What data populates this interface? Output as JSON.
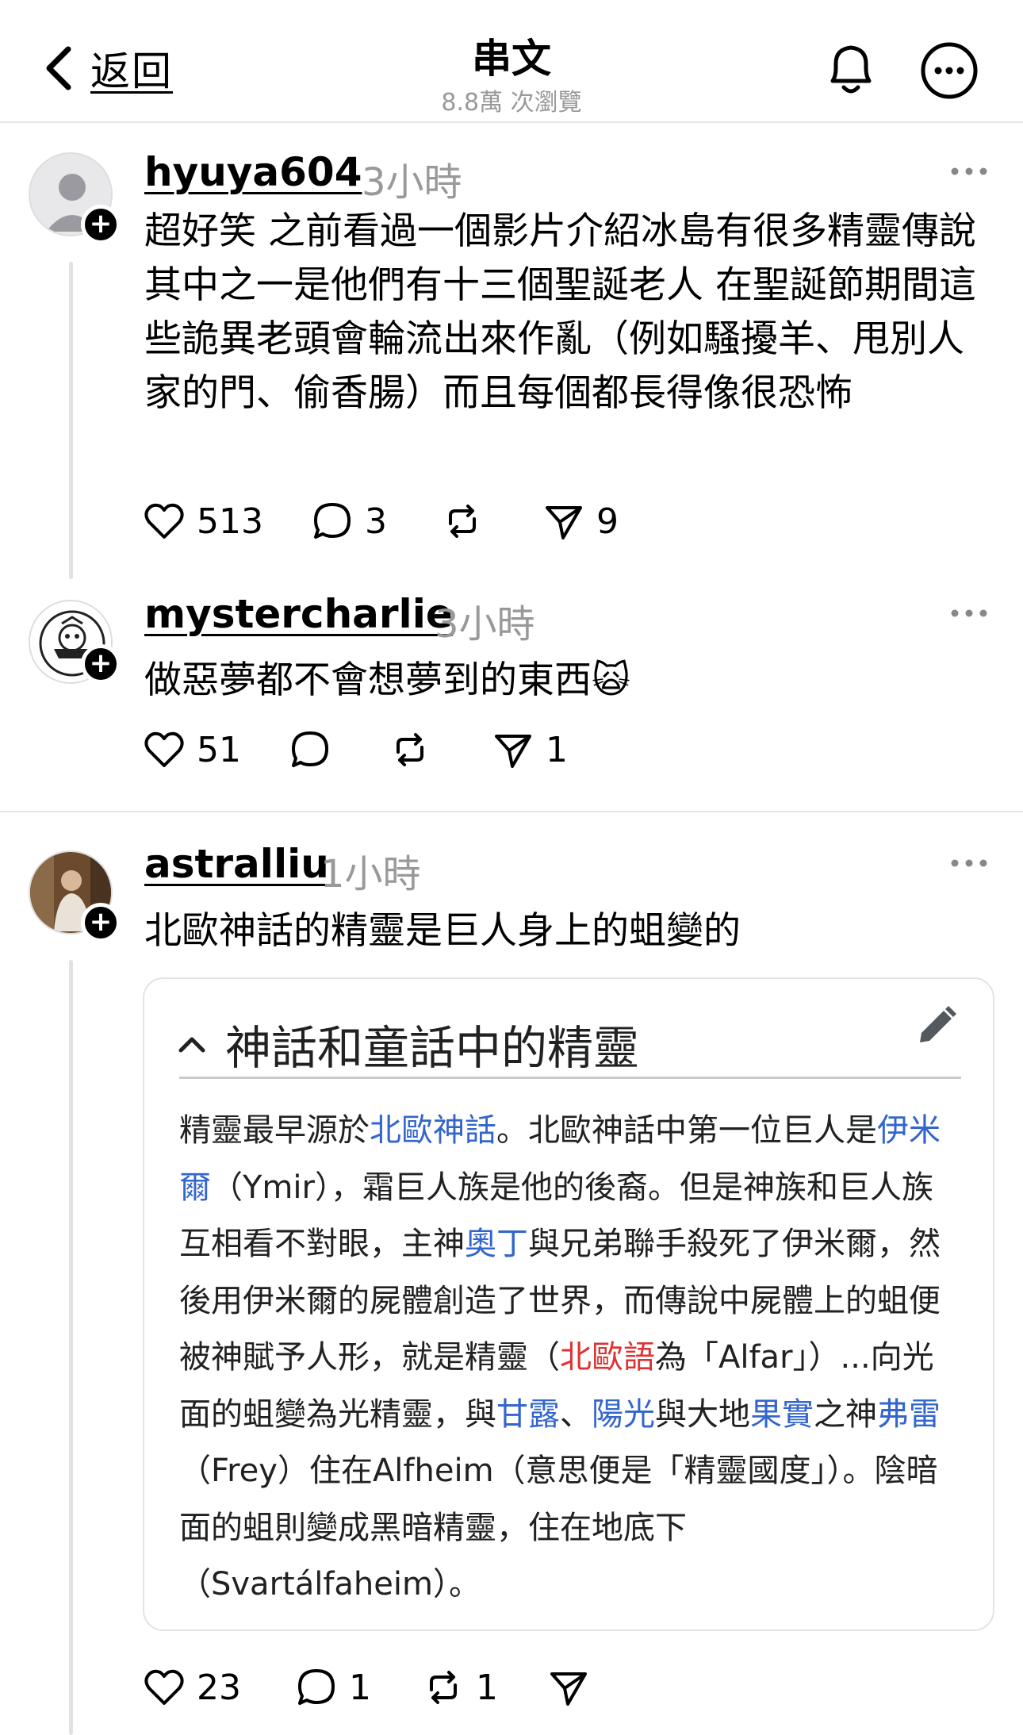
{
  "header": {
    "back_label": "返回",
    "title": "串文",
    "subtitle": "8.8萬 次瀏覽"
  },
  "posts": [
    {
      "username": "hyuya604",
      "time": "3小時",
      "text": "超好笑 之前看過一個影片介紹冰島有很多精靈傳說 其中之一是他們有十三個聖誕老人 在聖誕節期間這些詭異老頭會輪流出來作亂（例如騷擾羊、甩別人家的門、偷香腸）而且每個都長得像很恐怖",
      "likes": "513",
      "replies": "3",
      "reposts": "",
      "shares": "9"
    },
    {
      "username": "mystercharlie",
      "time": "3小時",
      "text": "做惡夢都不會想夢到的東西",
      "emoji": "🙀",
      "likes": "51",
      "replies": "",
      "reposts": "",
      "shares": "1"
    },
    {
      "username": "astralliu",
      "time": "1小時",
      "text": "北歐神話的精靈是巨人身上的蛆變的",
      "likes": "23",
      "replies": "1",
      "reposts": "1",
      "shares": ""
    }
  ],
  "wiki": {
    "title": "神話和童話中的精靈",
    "segments": [
      {
        "t": "精靈最早源於",
        "c": ""
      },
      {
        "t": "北歐神話",
        "c": "link"
      },
      {
        "t": "。北歐神話中第一位巨人是",
        "c": ""
      },
      {
        "t": "伊米爾",
        "c": "link"
      },
      {
        "t": "（Ymir），霜巨人族是他的後裔。但是神族和巨人族互相看不對眼，主神",
        "c": ""
      },
      {
        "t": "奧丁",
        "c": "link"
      },
      {
        "t": "與兄弟聯手殺死了伊米爾，然後用伊米爾的屍體創造了世界，而傳說中屍體上的蛆便被神賦予人形，就是精靈（",
        "c": ""
      },
      {
        "t": "北歐語",
        "c": "red"
      },
      {
        "t": "為「Alfar」）...向光面的蛆變為光精靈，與",
        "c": ""
      },
      {
        "t": "甘露",
        "c": "link"
      },
      {
        "t": "、",
        "c": ""
      },
      {
        "t": "陽光",
        "c": "link"
      },
      {
        "t": "與大地",
        "c": ""
      },
      {
        "t": "果實",
        "c": "link"
      },
      {
        "t": "之神",
        "c": ""
      },
      {
        "t": "弗雷",
        "c": "link"
      },
      {
        "t": "（Frey）住在Alfheim（意思便是「精靈國度」）。陰暗面的蛆則變成黑暗精靈，住在地底下（Svartálfaheim）。",
        "c": ""
      }
    ]
  },
  "colors": {
    "link": "#3366cc",
    "redlink": "#dd3333",
    "muted": "#999999",
    "divider": "#e6e6e6"
  },
  "icons": [
    "chevron-left-icon",
    "bell-icon",
    "more-circle-icon",
    "heart-icon",
    "comment-icon",
    "repost-icon",
    "share-icon",
    "ellipsis-icon",
    "pencil-icon",
    "chevron-up-icon",
    "plus-icon"
  ]
}
